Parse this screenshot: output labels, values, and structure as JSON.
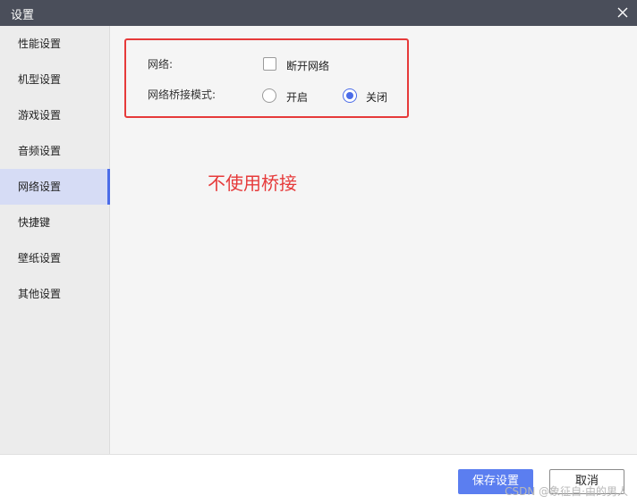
{
  "window": {
    "title": "设置",
    "close_icon": "close-icon"
  },
  "sidebar": {
    "items": [
      {
        "label": "性能设置"
      },
      {
        "label": "机型设置"
      },
      {
        "label": "游戏设置"
      },
      {
        "label": "音频设置"
      },
      {
        "label": "网络设置",
        "active": true
      },
      {
        "label": "快捷键"
      },
      {
        "label": "壁纸设置"
      },
      {
        "label": "其他设置"
      }
    ]
  },
  "network": {
    "network_label": "网络:",
    "disconnect_label": "断开网络",
    "disconnect_checked": false,
    "bridge_label": "网络桥接模式:",
    "bridge_options": [
      {
        "label": "开启",
        "checked": false
      },
      {
        "label": "关闭",
        "checked": true
      }
    ]
  },
  "annotation": {
    "text": "不使用桥接",
    "color": "#e63a3a"
  },
  "footer": {
    "save_label": "保存设置",
    "cancel_label": "取消"
  },
  "watermark": "CSDN @象征自·由的男人",
  "colors": {
    "accent": "#4b6ce8",
    "titlebar": "#4a4e5a",
    "highlight": "#e63a3a"
  }
}
